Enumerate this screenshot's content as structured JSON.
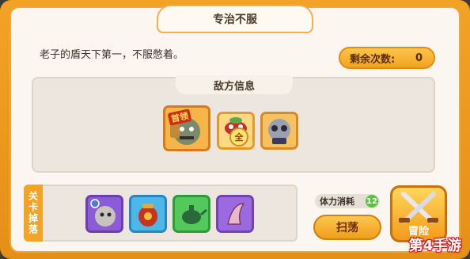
{
  "dialog": {
    "title": "专治不服",
    "quote": "老子的盾天下第一，不服憋着。",
    "remaining_label": "剩余次数:",
    "remaining_value": "0"
  },
  "enemy_info": {
    "header": "敌方信息",
    "units": [
      {
        "badge": "首领",
        "icon": "shield-boss-portrait-icon"
      },
      {
        "marker": "全",
        "icon": "turtle-creature-icon"
      },
      {
        "icon": "panda-warrior-icon"
      }
    ]
  },
  "drops": {
    "label": "关卡掉落",
    "items": [
      {
        "icon": "boss-portrait-fragment-icon"
      },
      {
        "icon": "red-pot-icon"
      },
      {
        "icon": "green-teapot-icon"
      },
      {
        "icon": "purple-scroll-icon"
      }
    ]
  },
  "stamina": {
    "label": "体力消耗",
    "value": "12"
  },
  "buttons": {
    "sweep": "扫荡",
    "adventure": "冒险"
  },
  "watermark": "第4手游",
  "colors": {
    "frame": "#f2a326",
    "panel": "#fbf6ef",
    "stamina_badge": "#57c23b"
  }
}
